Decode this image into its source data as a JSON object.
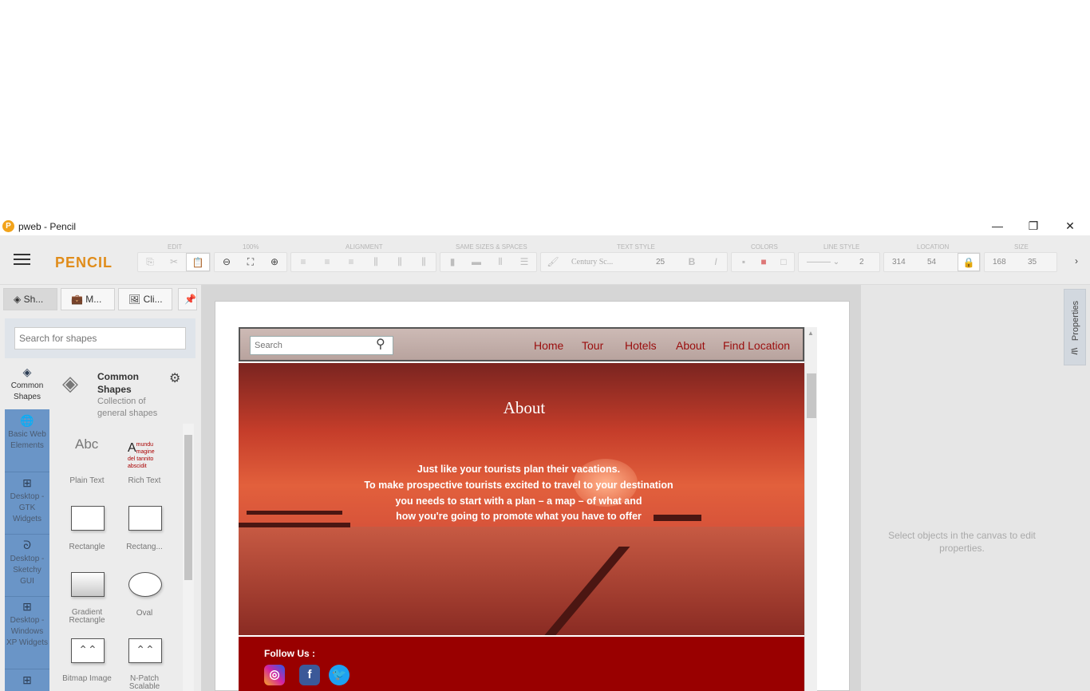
{
  "window": {
    "title": "pweb - Pencil",
    "controls": {
      "minimize": "—",
      "restore": "❐",
      "close": "✕"
    }
  },
  "toolbar": {
    "brand": "PENCIL",
    "groups": {
      "edit": "EDIT",
      "zoom": "100%",
      "alignment": "ALIGNMENT",
      "same_sizes": "SAME SIZES & SPACES",
      "text_style": "TEXT STYLE",
      "colors": "COLORS",
      "line_style": "LINE STYLE",
      "location": "LOCATION",
      "size": "SIZE"
    },
    "font_name": "Century Sc...",
    "font_size": "25",
    "line_width": "2",
    "location_x": "314",
    "location_y": "54",
    "size_w": "168",
    "size_h": "35"
  },
  "left_panel": {
    "tabs": [
      "Sh...",
      "M...",
      "Cli..."
    ],
    "search_placeholder": "Search for shapes",
    "collection": {
      "title": "Common Shapes",
      "description": "Collection of general shapes"
    },
    "categories": [
      {
        "label": "Common Shapes",
        "icon": "layers-icon"
      },
      {
        "label": "Basic Web Elements",
        "icon": "globe-icon"
      },
      {
        "label": "Desktop - GTK Widgets",
        "icon": "grid-icon"
      },
      {
        "label": "Desktop - Sketchy GUI",
        "icon": "squiggle-icon"
      },
      {
        "label": "Desktop - Windows XP Widgets",
        "icon": "grid-icon"
      }
    ],
    "shapes": [
      {
        "label": "Plain Text",
        "preview": "Abc"
      },
      {
        "label": "Rich Text",
        "preview": "mundu magine del tannito abscidit"
      },
      {
        "label": "Rectangle"
      },
      {
        "label": "Rectang..."
      },
      {
        "label": "Gradient Rectangle"
      },
      {
        "label": "Oval"
      },
      {
        "label": "Bitmap Image"
      },
      {
        "label": "N-Patch Scalable"
      }
    ]
  },
  "mockup": {
    "search_placeholder": "Search",
    "nav": [
      "Home",
      "Tour",
      "Hotels",
      "About",
      "Find Location"
    ],
    "hero_title": "About",
    "hero_lines": [
      "Just like your tourists plan their vacations.",
      "To make prospective tourists excited to travel to your destination",
      "you needs to start with a plan – a map – of what and",
      "how you're going to promote what you have to offer"
    ],
    "footer_follow": "Follow Us :"
  },
  "right_panel": {
    "tab_label": "Properties",
    "hint": "Select objects in the canvas to edit properties."
  },
  "colors": {
    "brand": "#e08c1a",
    "nav_link": "#9a0d0d",
    "footer": "#990000",
    "category_column": "#6a95c7"
  }
}
